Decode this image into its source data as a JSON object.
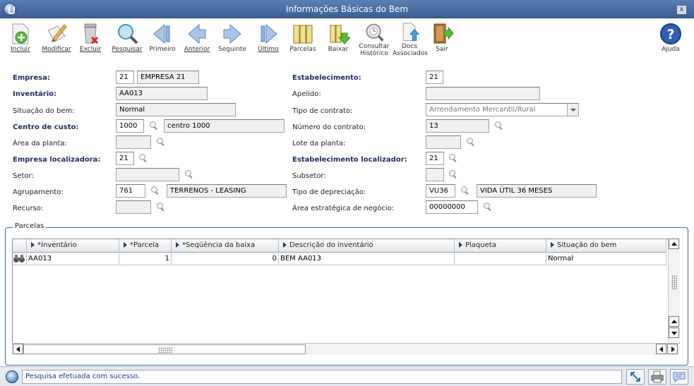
{
  "window": {
    "title": "Informações Básicas do Bem",
    "close_label": "x"
  },
  "toolbar": {
    "incluir": "Incluir",
    "modificar": "Modificar",
    "excluir": "Excluir",
    "pesquisar": "Pesquisar",
    "primeiro": "Primeiro",
    "anterior": "Anterior",
    "seguinte": "Seguinte",
    "ultimo": "Último",
    "parcelas": "Parcelas",
    "baixar": "Baixar",
    "consultar_1": "Consultar",
    "consultar_2": "Histórico",
    "docs_1": "Docs",
    "docs_2": "Associados",
    "sair": "Sair",
    "ajuda": "Ajuda"
  },
  "form": {
    "empresa": {
      "label": "Empresa:",
      "code": "21",
      "name": "EMPRESA 21"
    },
    "estabelecimento": {
      "label": "Estabelecimento:",
      "value": "21"
    },
    "inventario": {
      "label": "Inventário:",
      "value": "AA013"
    },
    "apelido": {
      "label": "Apelido:",
      "value": ""
    },
    "situacao": {
      "label": "Situação do bem:",
      "value": "Normal"
    },
    "tipo_contrato": {
      "label": "Tipo de contrato:",
      "value": "Arrendamento Mercantil/Rural"
    },
    "centro_custo": {
      "label": "Centro de custo:",
      "code": "1000",
      "name": "centro 1000"
    },
    "numero_contrato": {
      "label": "Número do contrato:",
      "value": "13"
    },
    "area_planta": {
      "label": "Área da planta:",
      "value": ""
    },
    "lote_planta": {
      "label": "Lote da planta:",
      "value": ""
    },
    "empresa_localizadora": {
      "label": "Empresa localizadora:",
      "value": "21"
    },
    "estab_localizador": {
      "label": "Estabelecimento localizador:",
      "value": "21"
    },
    "setor": {
      "label": "Setor:",
      "value": ""
    },
    "subsetor": {
      "label": "Subsetor:",
      "value": ""
    },
    "agrupamento": {
      "label": "Agrupamento:",
      "code": "761",
      "name": "TERRENOS - LEASING"
    },
    "tipo_depreciacao": {
      "label": "Tipo de depreciação:",
      "code": "VU36",
      "name": "VIDA ÚTIL 36 MESES"
    },
    "recurso": {
      "label": "Recurso:",
      "value": ""
    },
    "area_estrategica": {
      "label": "Área estratégica de negócio:",
      "value": "00000000"
    }
  },
  "parcelas": {
    "title": "Parcelas",
    "columns": [
      "*Inventário",
      "*Parcela",
      "*Seqüência da baixa",
      "Descrição do inventário",
      "Plaqueta",
      "Situação do bem"
    ],
    "rows": [
      [
        "AA013",
        "1",
        "0",
        "BEM AA013",
        "",
        "Normal"
      ]
    ]
  },
  "status": {
    "message": "Pesquisa efetuada com sucesso."
  }
}
